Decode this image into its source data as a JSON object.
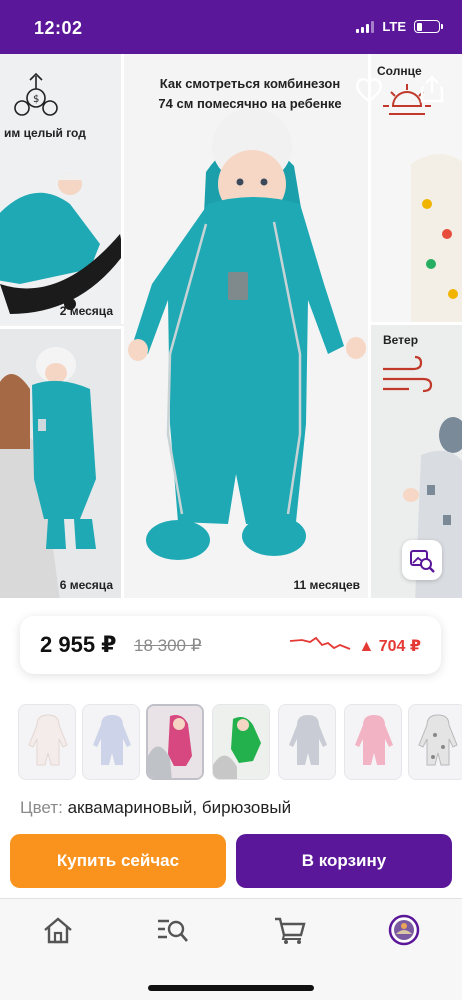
{
  "status_bar": {
    "time": "12:02",
    "network": "LTE",
    "battery_level": 0.28
  },
  "gallery": {
    "headline_line1": "Как смотреться комбинезон",
    "headline_line2": "74 см помесячно на ребенке",
    "captions": {
      "left_top_label": "им целый год",
      "left_top_age": "2 месяца",
      "left_bottom_age": "6 месяца",
      "center_age": "11 месяцев",
      "right_top_label": "Солнце",
      "right_bottom_label": "Ветер"
    },
    "suit_color": "#1fa9b5"
  },
  "price": {
    "current": "2 955 ₽",
    "old": "18 300 ₽",
    "drop": "▲ 704 ₽",
    "trend_color": "#e53935"
  },
  "thumbnails": [
    {
      "color": "#f3ecea",
      "kind": "cream"
    },
    {
      "color": "#cdd3e8",
      "kind": "lavender"
    },
    {
      "color": "#d6487f",
      "kind": "pink-photo"
    },
    {
      "color": "#22b14c",
      "kind": "green-photo"
    },
    {
      "color": "#c9ccd4",
      "kind": "grey"
    },
    {
      "color": "#f2b3c4",
      "kind": "pink"
    },
    {
      "color": "#e4e4e4",
      "kind": "white-print"
    }
  ],
  "color_info": {
    "label": "Цвет:",
    "value": "аквамариновый, бирюзовый"
  },
  "actions": {
    "buy_now": "Купить сейчас",
    "add_to_cart": "В корзину"
  },
  "colors": {
    "brand_purple": "#5b1799",
    "accent_orange": "#f9931e"
  }
}
